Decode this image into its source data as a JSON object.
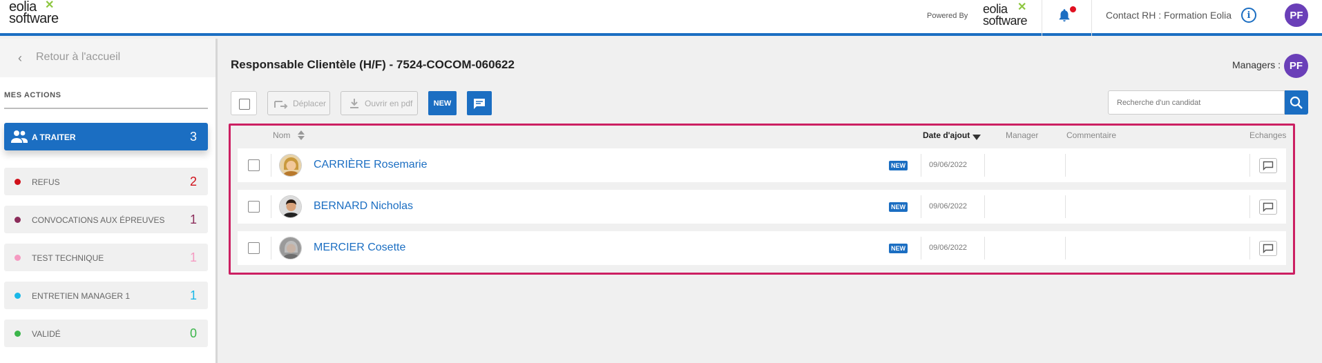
{
  "header": {
    "logo_line1": "eolia",
    "logo_line2": "software",
    "powered_by": "Powered By",
    "contact": "Contact RH : Formation Eolia",
    "user_initials": "PF"
  },
  "sidebar": {
    "back_label": "Retour à l'accueil",
    "section_title": "MES ACTIONS",
    "steps": [
      {
        "label": "A TRAITER",
        "count": "3",
        "color": "#ffffff",
        "count_color": "#ffffff",
        "active": true
      },
      {
        "label": "REFUS",
        "count": "2",
        "color": "#d0101a",
        "count_color": "#d0101a"
      },
      {
        "label": "CONVOCATIONS AUX ÉPREUVES",
        "count": "1",
        "color": "#8b2c5a",
        "count_color": "#8b2c5a"
      },
      {
        "label": "TEST TECHNIQUE",
        "count": "1",
        "color": "#f59ac1",
        "count_color": "#f59ac1"
      },
      {
        "label": "ENTRETIEN MANAGER 1",
        "count": "1",
        "color": "#1ab8e8",
        "count_color": "#1ab8e8"
      },
      {
        "label": "VALIDÉ",
        "count": "0",
        "color": "#3bb54a",
        "count_color": "#3bb54a"
      }
    ]
  },
  "main": {
    "job_title": "Responsable Clientèle (H/F) - 7524-COCOM-060622",
    "managers_label": "Managers :",
    "manager_initials": "PF",
    "toolbar": {
      "move_label": "Déplacer",
      "open_pdf_label": "Ouvrir en pdf",
      "new_label": "NEW"
    },
    "search": {
      "placeholder": "Recherche d'un candidat"
    },
    "columns": {
      "name": "Nom",
      "date_added": "Date d'ajout",
      "manager": "Manager",
      "comment": "Commentaire",
      "exchanges": "Echanges"
    },
    "candidates": [
      {
        "name": "CARRIÈRE Rosemarie",
        "badge": "NEW",
        "date": "09/06/2022"
      },
      {
        "name": "BERNARD Nicholas",
        "badge": "NEW",
        "date": "09/06/2022"
      },
      {
        "name": "MERCIER Cosette",
        "badge": "NEW",
        "date": "09/06/2022"
      }
    ]
  },
  "colors": {
    "accent": "#1b6ec2",
    "panel_border": "#cc1f62",
    "avatar": "#6a3fb8"
  }
}
